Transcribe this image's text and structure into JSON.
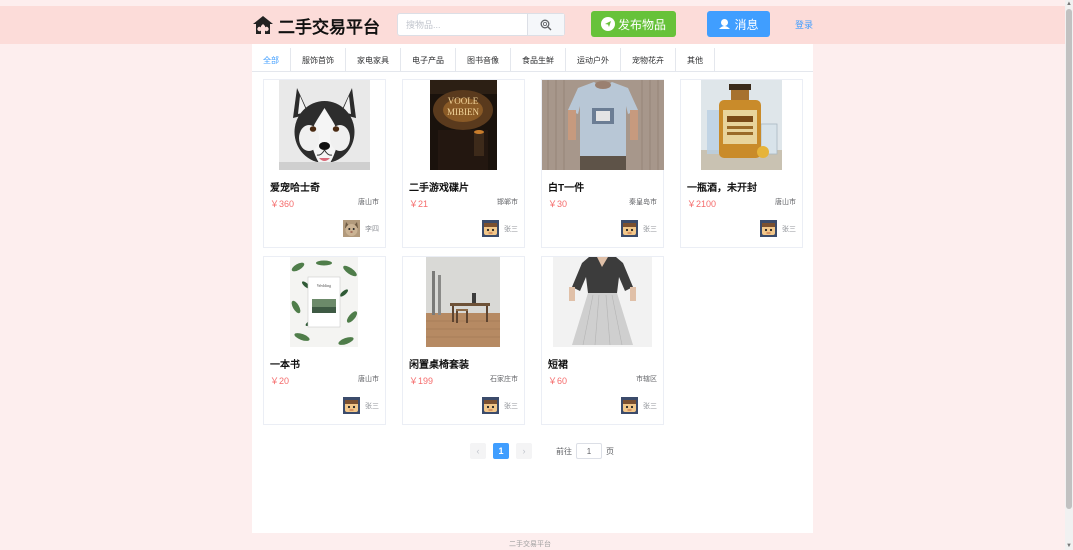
{
  "header": {
    "site_title": "二手交易平台",
    "search_placeholder": "搜物品...",
    "publish_label": "发布物品",
    "message_label": "消息",
    "login_label": "登录"
  },
  "tabs": [
    {
      "label": "全部",
      "active": true
    },
    {
      "label": "服饰首饰",
      "active": false
    },
    {
      "label": "家电家具",
      "active": false
    },
    {
      "label": "电子产品",
      "active": false
    },
    {
      "label": "图书音像",
      "active": false
    },
    {
      "label": "食品生鲜",
      "active": false
    },
    {
      "label": "运动户外",
      "active": false
    },
    {
      "label": "宠物花卉",
      "active": false
    },
    {
      "label": "其他",
      "active": false
    }
  ],
  "products": [
    {
      "title": "爱宠哈士奇",
      "price": "￥360",
      "city": "唐山市",
      "seller": "李四",
      "image": "husky-photo"
    },
    {
      "title": "二手游戏碟片",
      "price": "￥21",
      "city": "邯郸市",
      "seller": "张三",
      "image": "game-disc-photo"
    },
    {
      "title": "白T一件",
      "price": "￥30",
      "city": "秦皇岛市",
      "seller": "张三",
      "image": "white-tshirt-photo"
    },
    {
      "title": "一瓶酒，未开封",
      "price": "￥2100",
      "city": "唐山市",
      "seller": "张三",
      "image": "liquor-bottle-photo"
    },
    {
      "title": "一本书",
      "price": "￥20",
      "city": "唐山市",
      "seller": "张三",
      "image": "book-photo"
    },
    {
      "title": "闲置桌椅套装",
      "price": "￥199",
      "city": "石家庄市",
      "seller": "张三",
      "image": "desk-chair-photo"
    },
    {
      "title": "短裙",
      "price": "￥60",
      "city": "市辖区",
      "seller": "张三",
      "image": "skirt-photo"
    }
  ],
  "pagination": {
    "prev": "‹",
    "current": "1",
    "next": "›",
    "goto_label": "前往",
    "goto_value": "1",
    "page_suffix": "页"
  },
  "footer": {
    "text": "二手交易平台"
  },
  "colors": {
    "header_bg": "#fcdcd9",
    "page_bg": "#fdeeee",
    "primary": "#409eff",
    "success": "#67c23a",
    "price": "#f56c6c"
  }
}
